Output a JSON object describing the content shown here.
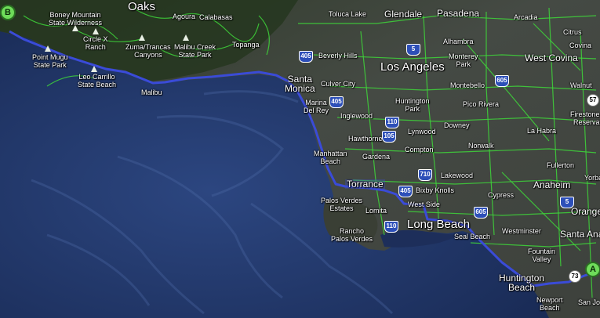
{
  "map": {
    "colors": {
      "ocean": "#1f3366",
      "land": "#3b4038",
      "hills": "#2a3b22",
      "streets": "#3ed63a",
      "route": "#3a4bd8"
    },
    "places": [
      {
        "id": "oaks",
        "name": "Oaks",
        "size": "big"
      },
      {
        "id": "boney",
        "name": "Boney Mountain\nState Wilderness",
        "size": "small"
      },
      {
        "id": "agoura",
        "name": "Agoura",
        "size": "small"
      },
      {
        "id": "calabasas",
        "name": "Calabasas",
        "size": "small"
      },
      {
        "id": "toluca",
        "name": "Toluca Lake",
        "size": "small"
      },
      {
        "id": "glendale",
        "name": "Glendale",
        "size": "med"
      },
      {
        "id": "pasadena",
        "name": "Pasadena",
        "size": "med"
      },
      {
        "id": "arcadia",
        "name": "Arcadia",
        "size": "small"
      },
      {
        "id": "citrus",
        "name": "Citrus",
        "size": "small"
      },
      {
        "id": "covina",
        "name": "Covina",
        "size": "small"
      },
      {
        "id": "circlex",
        "name": "Circle X\nRanch",
        "size": "small"
      },
      {
        "id": "zuma",
        "name": "Zuma/Trancas\nCanyons",
        "size": "small"
      },
      {
        "id": "malibucreek",
        "name": "Malibu Creek\nState Park",
        "size": "small"
      },
      {
        "id": "topanga",
        "name": "Topanga",
        "size": "small"
      },
      {
        "id": "beverly",
        "name": "Beverly Hills",
        "size": "small"
      },
      {
        "id": "alhambra",
        "name": "Alhambra",
        "size": "small"
      },
      {
        "id": "monterey",
        "name": "Monterey\nPark",
        "size": "small"
      },
      {
        "id": "westcovina",
        "name": "West Covina",
        "size": "med"
      },
      {
        "id": "pointmugu",
        "name": "Point Mugu\nState Park",
        "size": "small"
      },
      {
        "id": "losangeles",
        "name": "Los Angeles",
        "size": "big"
      },
      {
        "id": "leocarrillo",
        "name": "Leo Carrillo\nState Beach",
        "size": "small"
      },
      {
        "id": "malibu",
        "name": "Malibu",
        "size": "small"
      },
      {
        "id": "santamonica",
        "name": "Santa\nMonica",
        "size": "med"
      },
      {
        "id": "culver",
        "name": "Culver City",
        "size": "small"
      },
      {
        "id": "montebello",
        "name": "Montebello",
        "size": "small"
      },
      {
        "id": "walnut",
        "name": "Walnut",
        "size": "small"
      },
      {
        "id": "huntingtonpark",
        "name": "Huntington\nPark",
        "size": "small"
      },
      {
        "id": "picorivera",
        "name": "Pico Rivera",
        "size": "small"
      },
      {
        "id": "marina",
        "name": "Marina\nDel Rey",
        "size": "small"
      },
      {
        "id": "inglewood",
        "name": "Inglewood",
        "size": "small"
      },
      {
        "id": "downey",
        "name": "Downey",
        "size": "small"
      },
      {
        "id": "firestone",
        "name": "Firestone S\nReservati",
        "size": "small"
      },
      {
        "id": "hawthorne",
        "name": "Hawthorne",
        "size": "small"
      },
      {
        "id": "lynwood",
        "name": "Lynwood",
        "size": "small"
      },
      {
        "id": "norwalk",
        "name": "Norwalk",
        "size": "small"
      },
      {
        "id": "lahabra",
        "name": "La Habra",
        "size": "small"
      },
      {
        "id": "compton",
        "name": "Compton",
        "size": "small"
      },
      {
        "id": "manhattan",
        "name": "Manhattan\nBeach",
        "size": "small"
      },
      {
        "id": "gardena",
        "name": "Gardena",
        "size": "small"
      },
      {
        "id": "fullerton",
        "name": "Fullerton",
        "size": "small"
      },
      {
        "id": "lakewood",
        "name": "Lakewood",
        "size": "small"
      },
      {
        "id": "torrance",
        "name": "Torrance",
        "size": "med"
      },
      {
        "id": "anaheim",
        "name": "Anaheim",
        "size": "med"
      },
      {
        "id": "yorba",
        "name": "Yorba",
        "size": "small"
      },
      {
        "id": "bixby",
        "name": "Bixby Knolls",
        "size": "small"
      },
      {
        "id": "cypress",
        "name": "Cypress",
        "size": "small"
      },
      {
        "id": "palosverdesestates",
        "name": "Palos Verdes\nEstates",
        "size": "small"
      },
      {
        "id": "westside",
        "name": "West Side",
        "size": "small"
      },
      {
        "id": "lomita",
        "name": "Lomita",
        "size": "small"
      },
      {
        "id": "orange",
        "name": "Orange",
        "size": "med"
      },
      {
        "id": "longbeach",
        "name": "Long Beach",
        "size": "big"
      },
      {
        "id": "westminster",
        "name": "Westminster",
        "size": "small"
      },
      {
        "id": "santaana",
        "name": "Santa Ana",
        "size": "med"
      },
      {
        "id": "rancho",
        "name": "Rancho\nPalos Verdes",
        "size": "small"
      },
      {
        "id": "sealbeach",
        "name": "Seal Beach",
        "size": "small"
      },
      {
        "id": "fountain",
        "name": "Fountain\nValley",
        "size": "small"
      },
      {
        "id": "huntingtonbeach",
        "name": "Huntington\nBeach",
        "size": "med"
      },
      {
        "id": "newport",
        "name": "Newport\nBeach",
        "size": "small"
      },
      {
        "id": "sanjo",
        "name": "San Jo",
        "size": "small"
      }
    ],
    "highways": [
      {
        "id": "i5a",
        "num": "5",
        "type": "interstate"
      },
      {
        "id": "i405a",
        "num": "405",
        "type": "interstate"
      },
      {
        "id": "i605a",
        "num": "605",
        "type": "interstate"
      },
      {
        "id": "s57",
        "num": "57",
        "type": "state"
      },
      {
        "id": "i405b",
        "num": "405",
        "type": "interstate"
      },
      {
        "id": "i110a",
        "num": "110",
        "type": "interstate"
      },
      {
        "id": "i105",
        "num": "105",
        "type": "interstate"
      },
      {
        "id": "i710",
        "num": "710",
        "type": "interstate"
      },
      {
        "id": "i405c",
        "num": "405",
        "type": "interstate"
      },
      {
        "id": "i5b",
        "num": "5",
        "type": "interstate"
      },
      {
        "id": "i605b",
        "num": "605",
        "type": "interstate"
      },
      {
        "id": "i110b",
        "num": "110",
        "type": "interstate"
      },
      {
        "id": "s73",
        "num": "73",
        "type": "state"
      }
    ],
    "markers": [
      {
        "id": "start",
        "label": "B"
      },
      {
        "id": "end",
        "label": "A"
      }
    ]
  }
}
